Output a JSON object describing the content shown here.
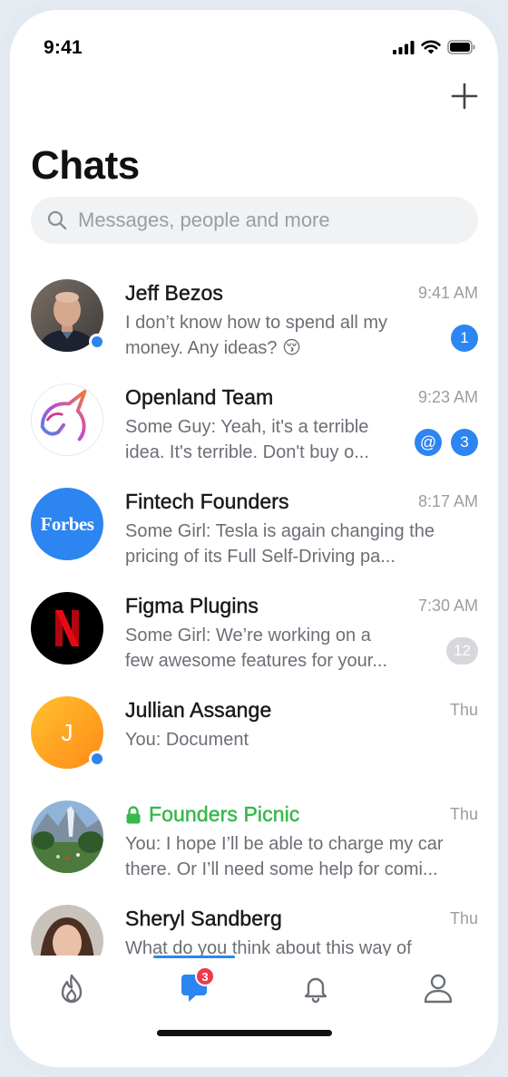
{
  "status_bar": {
    "time": "9:41"
  },
  "header": {
    "title": "Chats"
  },
  "search": {
    "placeholder": "Messages, people and more"
  },
  "chats": [
    {
      "name": "Jeff Bezos",
      "time": "9:41 AM",
      "preview": [
        "I don’t know how to spend all my",
        "money. Any ideas? 😚"
      ],
      "unread": "1",
      "online": true
    },
    {
      "name": "Openland Team",
      "time": "9:23 AM",
      "preview": [
        "Some Guy: Yeah, it's a terrible",
        "idea. It's terrible. Don't buy o..."
      ],
      "mention": "@",
      "unread": "3"
    },
    {
      "name": "Fintech Founders",
      "time": "8:17 AM",
      "preview": [
        "Some Girl: Tesla is again changing the",
        "pricing of its Full Self-Driving pa..."
      ],
      "avatar_text": "Forbes"
    },
    {
      "name": "Figma Plugins",
      "time": "7:30 AM",
      "preview": [
        "Some Girl: We’re working on a",
        "few awesome features for your..."
      ],
      "unread": "12",
      "muted": true
    },
    {
      "name": "Jullian Assange",
      "time": "Thu",
      "preview": [
        "You: Document"
      ],
      "avatar_text": "J",
      "online": true
    },
    {
      "name": "Founders Picnic",
      "time": "Thu",
      "preview": [
        "You: I hope I’ll be able to charge my car",
        "there. Or I’ll need some help for comi..."
      ],
      "secure": true
    },
    {
      "name": "Sheryl Sandberg",
      "time": "Thu",
      "preview": [
        "What do you think about this way of"
      ]
    }
  ],
  "tab_bar": {
    "chats_badge": "3"
  },
  "colors": {
    "accent": "#2c85f0",
    "secure_green": "#37b84a",
    "badge_red": "#ee3a4b",
    "muted_badge": "#d6d8dc"
  }
}
